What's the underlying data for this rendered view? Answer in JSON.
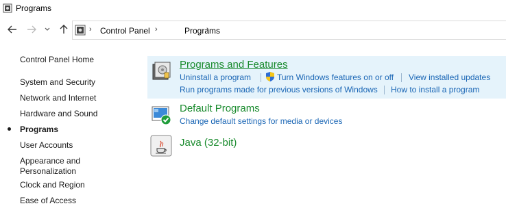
{
  "window": {
    "title": "Programs"
  },
  "nav": {
    "back_icon": "arrow-left-icon",
    "forward_icon": "arrow-right-icon",
    "recent_icon": "chevron-down-icon",
    "up_icon": "arrow-up-icon",
    "breadcrumb": [
      "Control Panel",
      "Programs"
    ]
  },
  "sidebar": {
    "home": "Control Panel Home",
    "items": [
      {
        "label": "System and Security"
      },
      {
        "label": "Network and Internet"
      },
      {
        "label": "Hardware and Sound"
      },
      {
        "label": "Programs",
        "current": true
      },
      {
        "label": "User Accounts"
      },
      {
        "label": "Appearance and"
      },
      {
        "label": "Personalization"
      },
      {
        "label": "Clock and Region"
      },
      {
        "label": "Ease of Access"
      }
    ]
  },
  "categories": [
    {
      "title": "Programs and Features",
      "icon": "programs-features-icon",
      "tasks": [
        "Uninstall a program",
        "Turn Windows features on or off",
        "View installed updates",
        "Run programs made for previous versions of Windows",
        "How to install a program"
      ]
    },
    {
      "title": "Default Programs",
      "icon": "default-programs-icon",
      "tasks": [
        "Change default settings for media or devices"
      ]
    },
    {
      "title": "Java (32-bit)",
      "icon": "java-icon",
      "tasks": []
    }
  ],
  "colors": {
    "category_title": "#188a2c",
    "task_link": "#1a66b5",
    "highlight": "#e5f3fb"
  }
}
